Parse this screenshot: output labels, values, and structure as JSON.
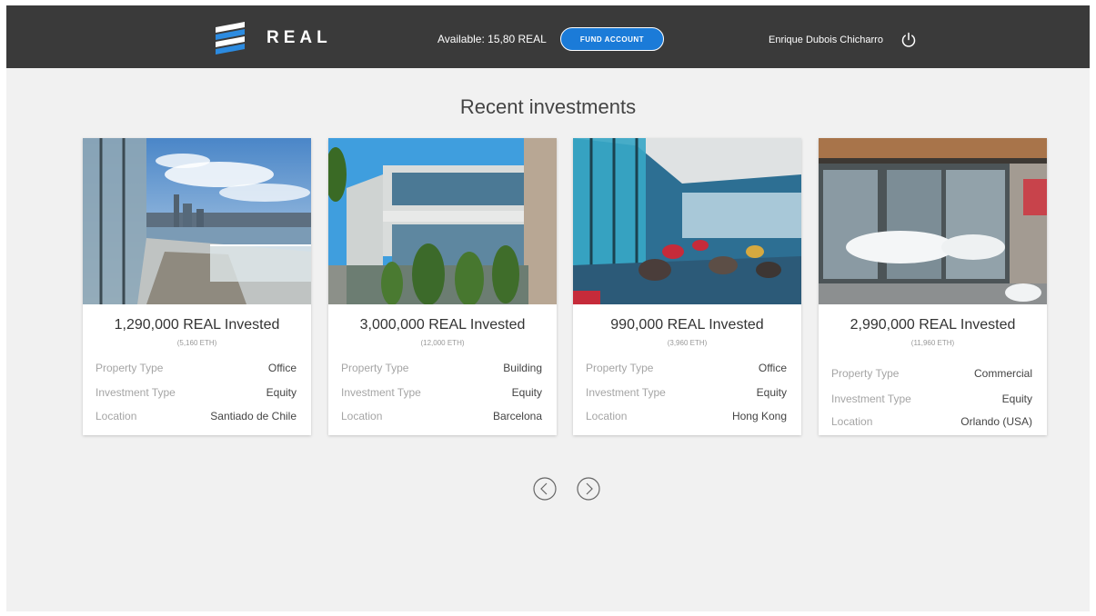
{
  "header": {
    "brand": "REAL",
    "balance": "Available: 15,80 REAL",
    "fund_button": "FUND ACCOUNT",
    "user_name": "Enrique Dubois Chicharro",
    "icons": {
      "logo": "real-logo-icon",
      "logout": "power-icon"
    },
    "colors": {
      "bar": "#3a3a3a",
      "accent": "#1b7bd8"
    }
  },
  "title": "Recent investments",
  "labels": {
    "property_type": "Property Type",
    "investment_type": "Investment Type",
    "location": "Location"
  },
  "cards": [
    {
      "amount": "1,290,000 REAL Invested",
      "eth": "(5,160 ETH)",
      "property_type": "Office",
      "investment_type": "Equity",
      "location": "Santiado de Chile",
      "image": "rooftop-terrace-city-skyline"
    },
    {
      "amount": "3,000,000 REAL Invested",
      "eth": "(12,000 ETH)",
      "property_type": "Building",
      "investment_type": "Equity",
      "location": "Barcelona",
      "image": "glass-office-building"
    },
    {
      "amount": "990,000 REAL Invested",
      "eth": "(3,960 ETH)",
      "property_type": "Office",
      "investment_type": "Equity",
      "location": "Hong Kong",
      "image": "office-lounge-interior"
    },
    {
      "amount": "2,990,000 REAL Invested",
      "eth": "(11,960 ETH)",
      "property_type": "Commercial",
      "investment_type": "Equity",
      "location": "Orlando (USA)",
      "image": "storefront-entrance-snow"
    }
  ],
  "pager": {
    "prev_icon": "chevron-left-icon",
    "next_icon": "chevron-right-icon"
  }
}
